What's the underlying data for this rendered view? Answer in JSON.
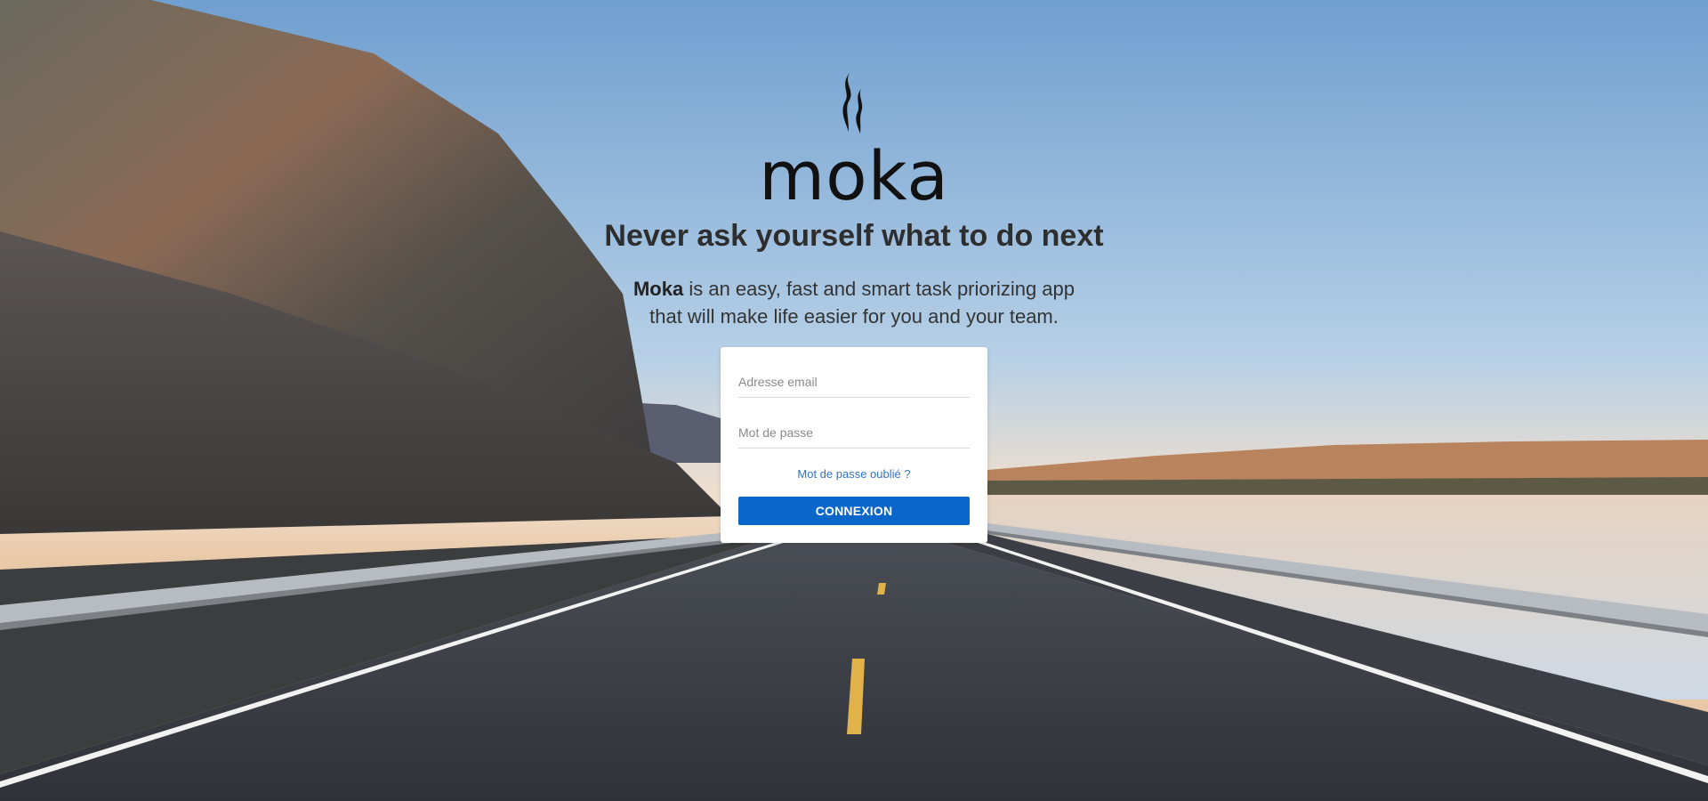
{
  "brand": {
    "name": "moka",
    "logo_icon": "steam-icon"
  },
  "hero": {
    "headline": "Never ask yourself what to do next",
    "tagline_brand": "Moka",
    "tagline_rest_line1": " is an easy, fast and smart task priorizing app",
    "tagline_line2": "that will make life easier for you and your team."
  },
  "login": {
    "email_placeholder": "Adresse email",
    "password_placeholder": "Mot de passe",
    "email_value": "",
    "password_value": "",
    "forgot_label": "Mot de passe oublié ?",
    "submit_label": "CONNEXION"
  },
  "colors": {
    "accent": "#0a66c8",
    "link": "#2f73c6",
    "heading": "#2e2e2e"
  },
  "background": {
    "subject": "empty road with guardrails between cliffs and a lake at sunrise"
  }
}
